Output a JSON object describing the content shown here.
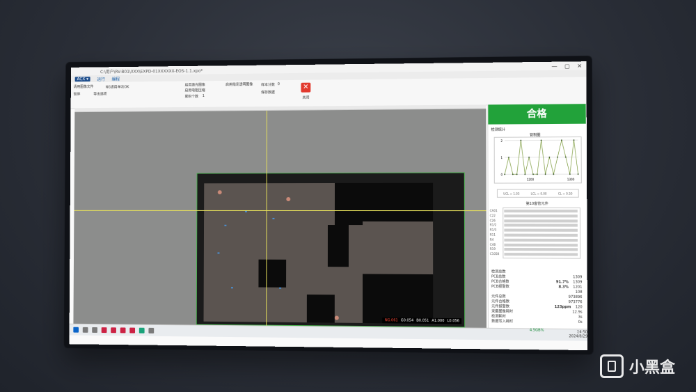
{
  "window": {
    "title": "C:\\用户\\RV-B01\\XXX\\EXPD-01XXXXXX-EOS-1.1.xpo*",
    "tabs": [
      "ACX",
      "运行",
      "编程"
    ],
    "menu_button": "ACX ▾"
  },
  "ribbon": {
    "file_label": "请用图像文件",
    "log_label": "暂停",
    "trend_label": "NG适用",
    "trend_value": "单次OK",
    "export_label": "导出选项",
    "option1": "启用激光图像",
    "option2": "启用电阻压缩",
    "option3": "启用指定透明图像",
    "count_label": "样本计数",
    "count_value": "0",
    "save_label": "保存数据",
    "delete_label": "关闭",
    "checkbox_label": "累积个数",
    "checkbox_value": "1"
  },
  "canvas": {
    "coord_red": "NG.061",
    "coord_1": "G0.054",
    "coord_2": "B0.051",
    "coord_3": "A1.000",
    "coord_4": "L0.056"
  },
  "panel": {
    "result": "合格",
    "trend_title": "检测统计",
    "chart_title": "管制图",
    "legend": [
      "UCL = 1.05",
      "LCL = 0.00",
      "CL = 0.50"
    ],
    "rank_title": "第10客管元件",
    "rank_labels": [
      "CA01",
      "C22",
      "C26",
      "R1/2",
      "R1/3",
      "R11",
      "R4",
      "C48",
      "R19",
      "C1058"
    ],
    "stats_title": "检测总数",
    "stats": [
      {
        "label": "PCB总数",
        "pct": "",
        "value": "1309"
      },
      {
        "label": "PCB合格数",
        "pct": "91.7%",
        "value": "1309"
      },
      {
        "label": "PCB报警数",
        "pct": "8.3%",
        "value": "1201"
      },
      {
        "label": "",
        "pct": "",
        "value": "108"
      },
      {
        "label": "元件总数",
        "pct": "",
        "value": "973896"
      },
      {
        "label": "元件合格数",
        "pct": "",
        "value": "973776"
      },
      {
        "label": "元件报警数",
        "pct": "123ppm",
        "value": "120"
      },
      {
        "label": "采集图像耗时",
        "pct": "",
        "value": "12.9s"
      },
      {
        "label": "检测耗时",
        "pct": "",
        "value": "3s"
      },
      {
        "label": "数据写入耗时",
        "pct": "",
        "value": "0s"
      }
    ]
  },
  "chart_data": {
    "type": "line",
    "title": "管制图",
    "x_ticks": [
      "1200",
      "1300"
    ],
    "y_ticks": [
      "2",
      "1",
      "0"
    ],
    "ylim": [
      0,
      2
    ],
    "series": [
      {
        "name": "",
        "values": [
          0,
          1,
          0,
          0,
          2,
          0,
          1,
          0,
          0,
          2,
          0,
          1,
          0,
          1,
          2,
          1,
          0,
          2,
          0
        ]
      }
    ]
  },
  "taskbar": {
    "time": "14:50",
    "date": "2024/8/29",
    "mem": "4.5GB%"
  },
  "watermark": "小黑盒"
}
